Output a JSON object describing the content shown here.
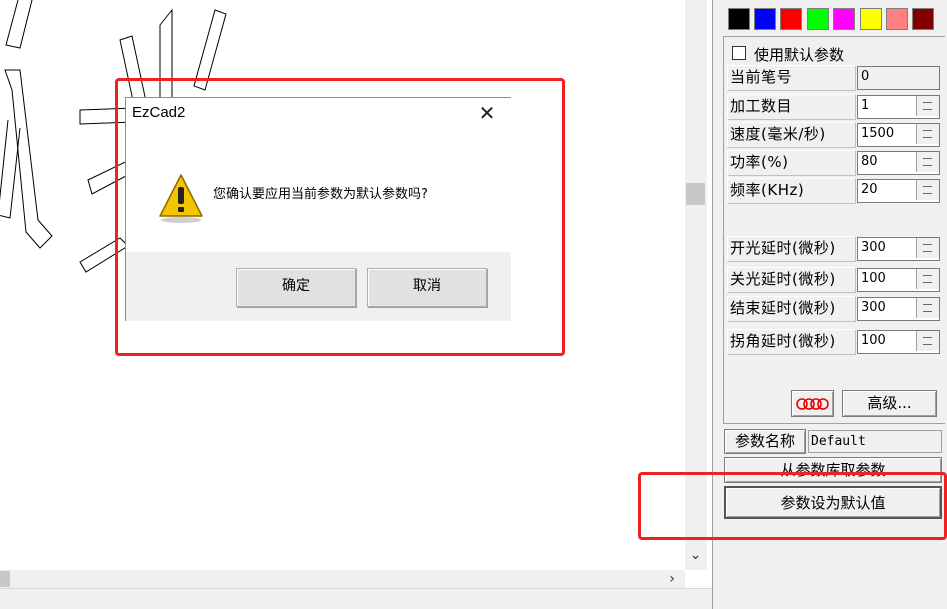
{
  "colors": {
    "swatches": [
      "#000000",
      "#0000ff",
      "#ff0000",
      "#00ff00",
      "#ff00ff",
      "#ffff00",
      "#ff8080",
      "#800000"
    ],
    "highlight": "#ee2222",
    "panel_bg": "#f0f0f0"
  },
  "panel": {
    "default_params_checkbox": {
      "label": "使用默认参数",
      "checked": false
    },
    "fields": [
      {
        "label": "当前笔号",
        "value": "0",
        "readonly": true
      },
      {
        "label": "加工数目",
        "value": "1"
      },
      {
        "label": "速度(毫米/秒)",
        "value": "1500"
      },
      {
        "label": "功率(%)",
        "value": "80"
      },
      {
        "label": "频率(KHz)",
        "value": "20"
      }
    ],
    "delay_fields": [
      {
        "label": "开光延时(微秒)",
        "value": "300"
      },
      {
        "label": "关光延时(微秒)",
        "value": "100"
      },
      {
        "label": "结束延时(微秒)",
        "value": "300"
      },
      {
        "label": "拐角延时(微秒)",
        "value": "100"
      }
    ],
    "advanced_label": "高级...",
    "param_name_label": "参数名称",
    "param_name_value": "Default",
    "load_from_lib_label": "从参数库取参数",
    "set_default_label": "参数设为默认值"
  },
  "dialog": {
    "title": "EzCad2",
    "message": "您确认要应用当前参数为默认参数吗?",
    "ok_label": "确定",
    "cancel_label": "取消",
    "icon": "warning-icon"
  }
}
